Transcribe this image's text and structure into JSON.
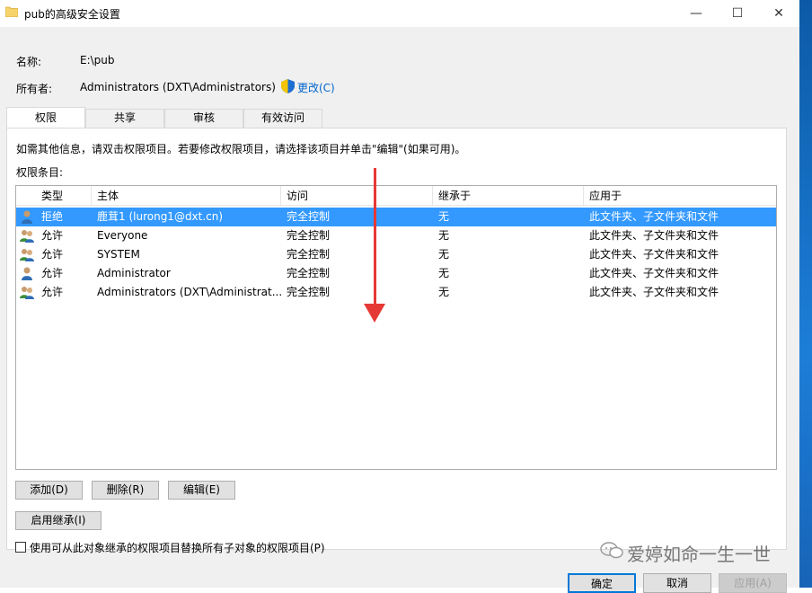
{
  "window": {
    "title": "pub的高级安全设置",
    "minimize_glyph": "—",
    "maximize_glyph": "☐",
    "close_glyph": "✕"
  },
  "info": {
    "name_label": "名称:",
    "name_value": "E:\\pub",
    "owner_label": "所有者:",
    "owner_value": "Administrators (DXT\\Administrators)",
    "change_link": "更改(C)"
  },
  "tabs": [
    {
      "label": "权限",
      "active": true
    },
    {
      "label": "共享",
      "active": false
    },
    {
      "label": "审核",
      "active": false
    },
    {
      "label": "有效访问",
      "active": false
    }
  ],
  "hint": "如需其他信息，请双击权限项目。若要修改权限项目，请选择该项目并单击\"编辑\"(如果可用)。",
  "entries_label": "权限条目:",
  "table": {
    "columns": [
      "类型",
      "主体",
      "访问",
      "继承于",
      "应用于"
    ],
    "rows": [
      {
        "type": "拒绝",
        "principal": "鹿茸1 (lurong1@dxt.cn)",
        "access": "完全控制",
        "inherited": "无",
        "applies": "此文件夹、子文件夹和文件",
        "icon": "single-user-icon",
        "selected": true
      },
      {
        "type": "允许",
        "principal": "Everyone",
        "access": "完全控制",
        "inherited": "无",
        "applies": "此文件夹、子文件夹和文件",
        "icon": "group-users-icon",
        "selected": false
      },
      {
        "type": "允许",
        "principal": "SYSTEM",
        "access": "完全控制",
        "inherited": "无",
        "applies": "此文件夹、子文件夹和文件",
        "icon": "group-users-icon",
        "selected": false
      },
      {
        "type": "允许",
        "principal": "Administrator",
        "access": "完全控制",
        "inherited": "无",
        "applies": "此文件夹、子文件夹和文件",
        "icon": "single-user-icon",
        "selected": false
      },
      {
        "type": "允许",
        "principal": "Administrators (DXT\\Administrat...",
        "access": "完全控制",
        "inherited": "无",
        "applies": "此文件夹、子文件夹和文件",
        "icon": "group-users-icon",
        "selected": false
      }
    ]
  },
  "buttons": {
    "add": "添加(D)",
    "remove": "删除(R)",
    "edit": "编辑(E)",
    "enable_inheritance": "启用继承(I)"
  },
  "checkbox_label": "使用可从此对象继承的权限项目替换所有子对象的权限项目(P)",
  "footer": {
    "ok": "确定",
    "cancel": "取消",
    "apply": "应用(A)"
  },
  "watermark": "爱婷如命一生一世",
  "colors": {
    "selection": "#3399ff",
    "link": "#0066cc",
    "annotation_arrow": "#e53935"
  }
}
